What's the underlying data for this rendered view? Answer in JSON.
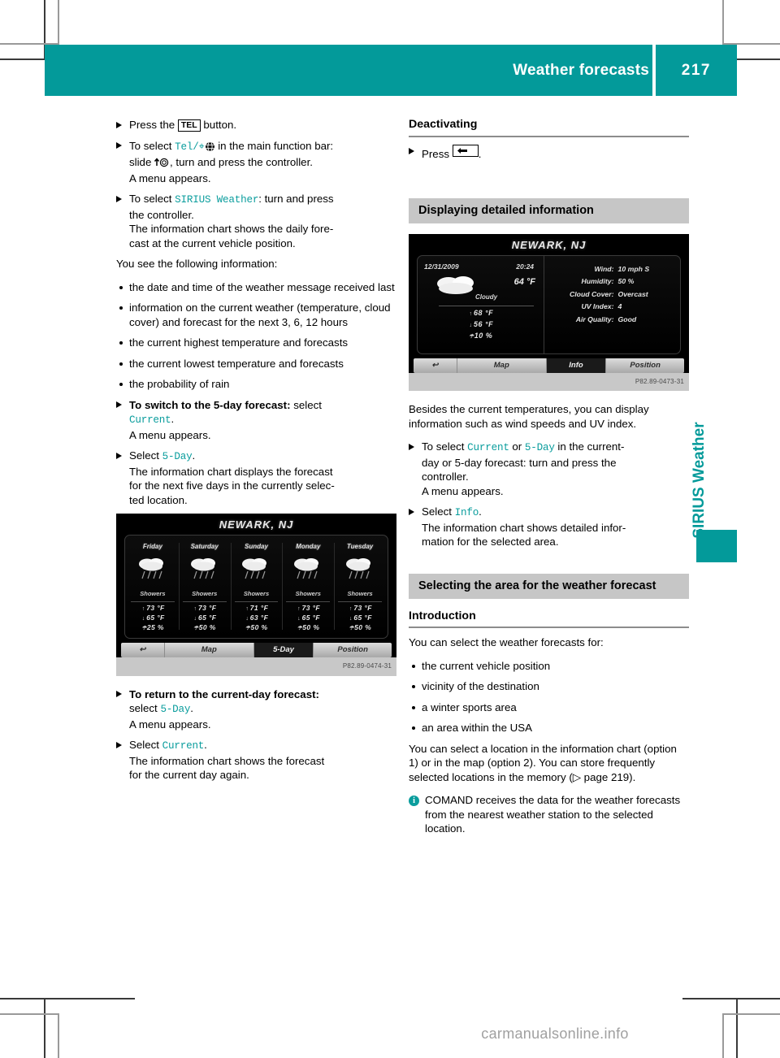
{
  "header": {
    "title": "Weather forecasts",
    "page_number": "217",
    "accent_color": "#039a9a"
  },
  "side_tab": {
    "label": "SIRIUS Weather"
  },
  "watermark": "carmanualsonline.info",
  "left_column": {
    "steps": [
      {
        "id": "press-tel",
        "pre": "Press the ",
        "key": "TEL",
        "post": " button."
      },
      {
        "id": "select-tel-main-bar",
        "pre": "To select ",
        "teal": "Tel/⌖",
        "post": " in the main function bar:",
        "lines": [
          "slide ↑◎, turn and press the controller.",
          "A menu appears."
        ]
      },
      {
        "id": "select-sirius-weather",
        "pre": "To select ",
        "teal": "SIRIUS Weather",
        "post": ": turn and press",
        "lines": [
          "the controller.",
          "The information chart shows the daily fore-",
          "cast at the current vehicle position."
        ]
      }
    ],
    "intro_line": "You see the following information:",
    "bullets": [
      "the date and time of the weather message received last",
      "information on the current weather (temperature, cloud cover) and forecast for the next 3, 6, 12 hours",
      "the current highest temperature and forecasts",
      "the current lowest temperature and forecasts",
      "the probability of rain"
    ],
    "steps2": [
      {
        "id": "switch-5day",
        "bold": "To switch to the 5-day forecast:",
        "post": " select",
        "teal_line": "Current",
        "lines": [
          "A menu appears."
        ]
      },
      {
        "id": "select-5day",
        "pre": "Select ",
        "teal": "5-Day",
        "post": ".",
        "lines": [
          "The information chart displays the forecast",
          "for the next five days in the currently selec-",
          "ted location."
        ]
      }
    ],
    "steps3": [
      {
        "id": "return-current-day",
        "bold": "To return to the current-day forecast:",
        "line2_pre": "select ",
        "line2_teal": "5-Day",
        "line2_post": ".",
        "lines": [
          "A menu appears."
        ]
      },
      {
        "id": "select-current",
        "pre": "Select ",
        "teal": "Current",
        "post": ".",
        "lines": [
          "The information chart shows the forecast",
          "for the current day again."
        ]
      }
    ]
  },
  "right_column": {
    "deactivating": {
      "heading": "Deactivating",
      "step_pre": "Press ",
      "step_post": "."
    },
    "detailed_info": {
      "heading": "Displaying detailed information",
      "paragraph": "Besides the current temperatures, you can display information such as wind speeds and UV index.",
      "steps": [
        {
          "id": "select-current-or-5day",
          "pre": "To select ",
          "teal1": "Current",
          "mid": " or ",
          "teal2": "5-Day",
          "post": " in the current-",
          "lines": [
            "day or 5-day forecast: turn and press the",
            "controller.",
            "A menu appears."
          ]
        },
        {
          "id": "select-info",
          "pre": "Select ",
          "teal": "Info",
          "post": ".",
          "lines": [
            "The information chart shows detailed infor-",
            "mation for the selected area."
          ]
        }
      ]
    },
    "selecting_area": {
      "heading": "Selecting the area for the weather forecast",
      "subheading": "Introduction",
      "intro": "You can select the weather forecasts for:",
      "bullets": [
        "the current vehicle position",
        "vicinity of the destination",
        "a winter sports area",
        "an area within the USA"
      ],
      "paragraph": "You can select a location in the information chart (option 1) or in the map (option 2). You can store frequently selected locations in the memory (▷ page 219).",
      "note": "COMAND receives the data for the weather forecasts from the nearest weather station to the selected location."
    }
  },
  "screenshot_5day": {
    "title": "NEWARK, NJ",
    "caption": "P82.89-0474-31",
    "days": [
      {
        "name": "Friday",
        "condition": "Showers",
        "high": "73 °F",
        "low": "65 °F",
        "rain": "25 %"
      },
      {
        "name": "Saturday",
        "condition": "Showers",
        "high": "73 °F",
        "low": "65 °F",
        "rain": "50 %"
      },
      {
        "name": "Sunday",
        "condition": "Showers",
        "high": "71 °F",
        "low": "63 °F",
        "rain": "50 %"
      },
      {
        "name": "Monday",
        "condition": "Showers",
        "high": "73 °F",
        "low": "65 °F",
        "rain": "50 %"
      },
      {
        "name": "Tuesday",
        "condition": "Showers",
        "high": "73 °F",
        "low": "65 °F",
        "rain": "50 %"
      }
    ],
    "bar": {
      "back": "↩",
      "map": "Map",
      "mid": "5-Day",
      "position": "Position"
    }
  },
  "screenshot_detail": {
    "title": "NEWARK, NJ",
    "caption": "P82.89-0473-31",
    "date": "12/31/2009",
    "time": "20:24",
    "current_temp": "64 °F",
    "condition": "Cloudy",
    "high": "68 °F",
    "low": "56 °F",
    "rain": "10 %",
    "details": [
      {
        "label": "Wind:",
        "value": "10 mph S"
      },
      {
        "label": "Humidity:",
        "value": "50 %"
      },
      {
        "label": "Cloud Cover:",
        "value": "Overcast"
      },
      {
        "label": "UV Index:",
        "value": "4"
      },
      {
        "label": "Air Quality:",
        "value": "Good"
      }
    ],
    "bar": {
      "back": "↩",
      "map": "Map",
      "mid": "Info",
      "position": "Position"
    }
  }
}
